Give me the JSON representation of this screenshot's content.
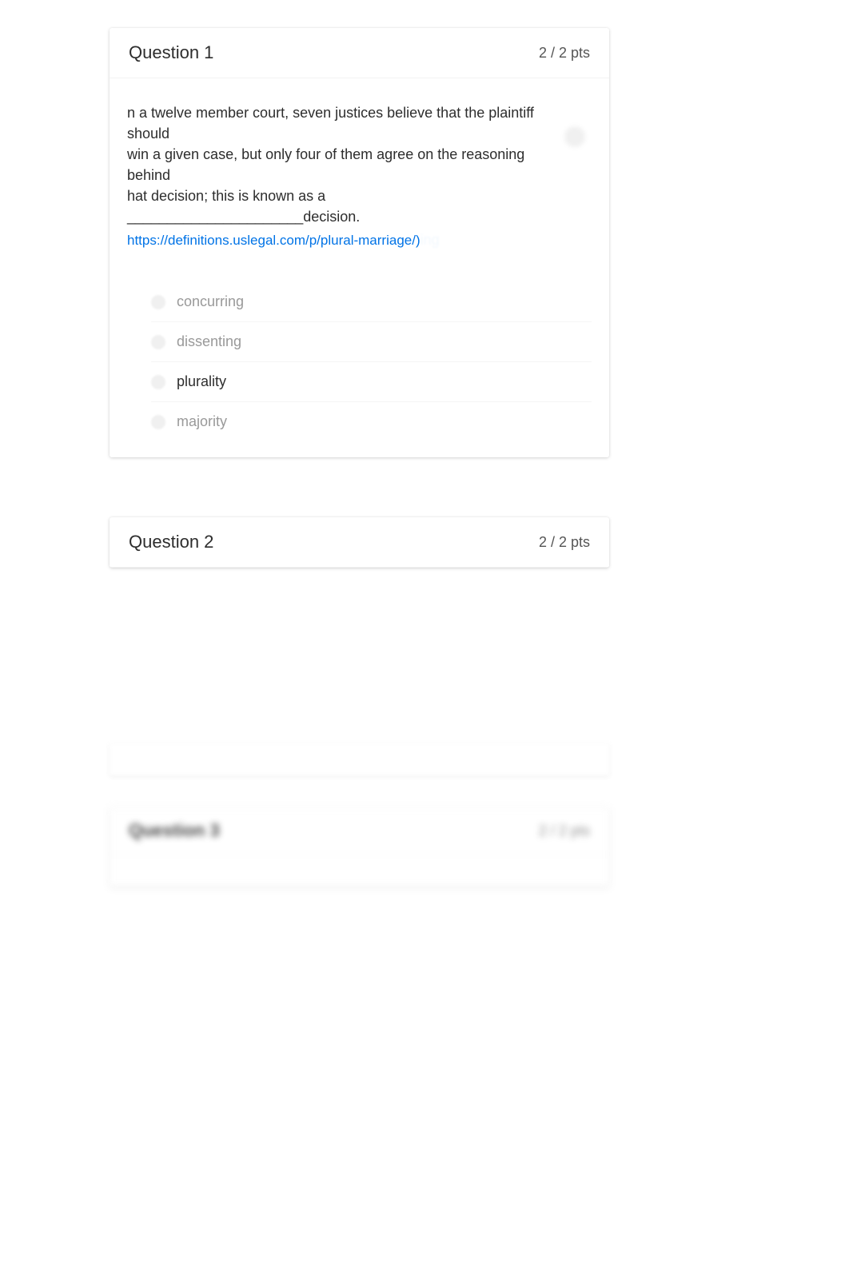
{
  "questions": [
    {
      "number_label": "Question 1",
      "points_label": "2 / 2 pts",
      "text_line1": "n a twelve member court, seven justices believe that the plaintiff should",
      "text_line2": "win a given case, but only four of them agree on the reasoning behind",
      "text_line3": "hat decision; this is known as a ______________________decision.",
      "link_text": "https://definitions.uslegal.com/p/plural-marriage/)",
      "link_trailing_faded": "ing",
      "answers": [
        {
          "label": "concurring",
          "selected": false
        },
        {
          "label": "dissenting",
          "selected": false
        },
        {
          "label": "plurality",
          "selected": true
        },
        {
          "label": "majority",
          "selected": false
        }
      ]
    },
    {
      "number_label": "Question 2",
      "points_label": "2 / 2 pts"
    },
    {
      "number_label": "Question 3",
      "points_label": "2 / 2 pts"
    }
  ]
}
